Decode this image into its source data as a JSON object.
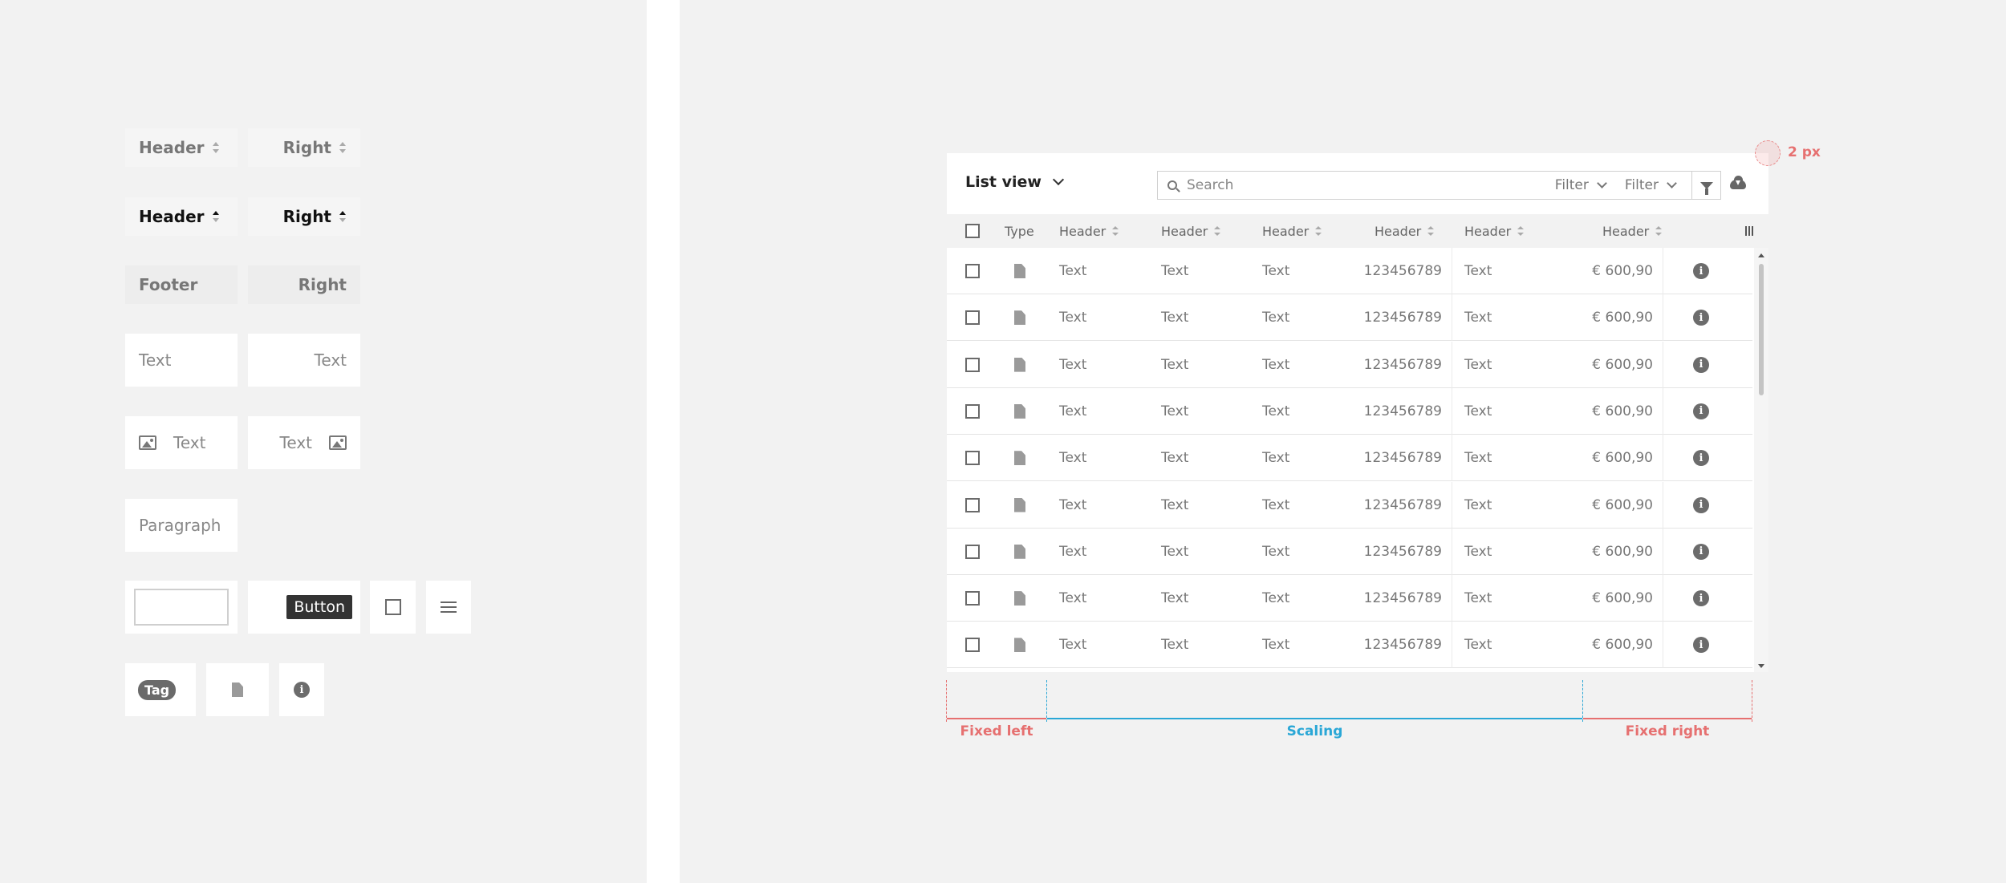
{
  "palette": {
    "header_label": "Header",
    "right_label": "Right",
    "footer_label": "Footer",
    "text_label": "Text",
    "paragraph_label": "Paragraph",
    "button_label": "Button",
    "tag_label": "Tag"
  },
  "table": {
    "view_title": "List view",
    "search_placeholder": "Search",
    "filter1": "Filter",
    "filter2": "Filter",
    "columns": [
      "Type",
      "Header",
      "Header",
      "Header",
      "Header",
      "Header",
      "Header"
    ],
    "rows": [
      {
        "c1": "Text",
        "c2": "Text",
        "c3": "Text",
        "c4": "123456789",
        "c5": "Text",
        "c6": "€ 600,90"
      },
      {
        "c1": "Text",
        "c2": "Text",
        "c3": "Text",
        "c4": "123456789",
        "c5": "Text",
        "c6": "€ 600,90"
      },
      {
        "c1": "Text",
        "c2": "Text",
        "c3": "Text",
        "c4": "123456789",
        "c5": "Text",
        "c6": "€ 600,90"
      },
      {
        "c1": "Text",
        "c2": "Text",
        "c3": "Text",
        "c4": "123456789",
        "c5": "Text",
        "c6": "€ 600,90"
      },
      {
        "c1": "Text",
        "c2": "Text",
        "c3": "Text",
        "c4": "123456789",
        "c5": "Text",
        "c6": "€ 600,90"
      },
      {
        "c1": "Text",
        "c2": "Text",
        "c3": "Text",
        "c4": "123456789",
        "c5": "Text",
        "c6": "€ 600,90"
      },
      {
        "c1": "Text",
        "c2": "Text",
        "c3": "Text",
        "c4": "123456789",
        "c5": "Text",
        "c6": "€ 600,90"
      },
      {
        "c1": "Text",
        "c2": "Text",
        "c3": "Text",
        "c4": "123456789",
        "c5": "Text",
        "c6": "€ 600,90"
      },
      {
        "c1": "Text",
        "c2": "Text",
        "c3": "Text",
        "c4": "123456789",
        "c5": "Text",
        "c6": "€ 600,90"
      }
    ]
  },
  "annotations": {
    "border_size": "2 px",
    "fixed_left": "Fixed left",
    "scaling": "Scaling",
    "fixed_right": "Fixed right",
    "red_color": "#e67070",
    "blue_color": "#2aa7d6"
  }
}
